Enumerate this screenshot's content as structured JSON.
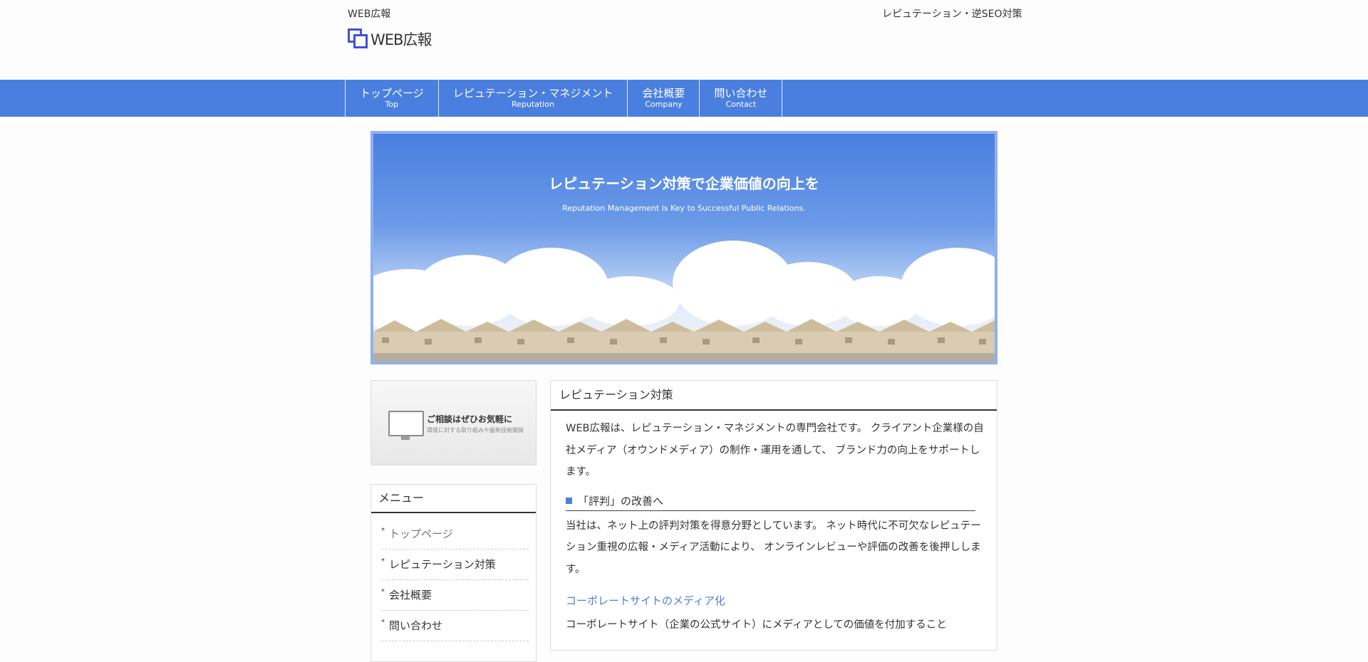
{
  "header": {
    "tagline": "WEB広報",
    "logo_text": "WEB広報",
    "right_text": "レピュテーション・逆SEO対策"
  },
  "nav": [
    {
      "ja": "トップページ",
      "en": "Top"
    },
    {
      "ja": "レピュテーション・マネジメント",
      "en": "Reputation"
    },
    {
      "ja": "会社概要",
      "en": "Company"
    },
    {
      "ja": "問い合わせ",
      "en": "Contact"
    }
  ],
  "hero": {
    "title": "レピュテーション対策で企業価値の向上を",
    "subtitle": "Reputation Management is Key to Successful Public Relations."
  },
  "sidebar": {
    "banner": {
      "title": "ご相談はぜひお気軽に",
      "subtitle": "環境に対する取り組みや最新技術開発"
    },
    "menu": {
      "title": "メニュー",
      "items": [
        "トップページ",
        "レピュテーション対策",
        "会社概要",
        "問い合わせ"
      ]
    }
  },
  "main": {
    "title": "レピュテーション対策",
    "intro": "WEB広報は、レピュテーション・マネジメントの専門会社です。 クライアント企業様の自社メディア（オウンドメディア）の制作・運用を通して、 ブランド力の向上をサポートします。",
    "section_heading": "「評判」の改善へ",
    "section_body": "当社は、ネット上の評判対策を得意分野としています。 ネット時代に不可欠なレピュテーション重視の広報・メディア活動により、 オンラインレビューや評価の改善を後押しします。",
    "link_text": "コーポレートサイトのメディア化",
    "link_body": "コーポレートサイト（企業の公式サイト）にメディアとしての価値を付加すること"
  },
  "colors": {
    "accent": "#4a7fe0",
    "logo": "#3f51d9"
  }
}
